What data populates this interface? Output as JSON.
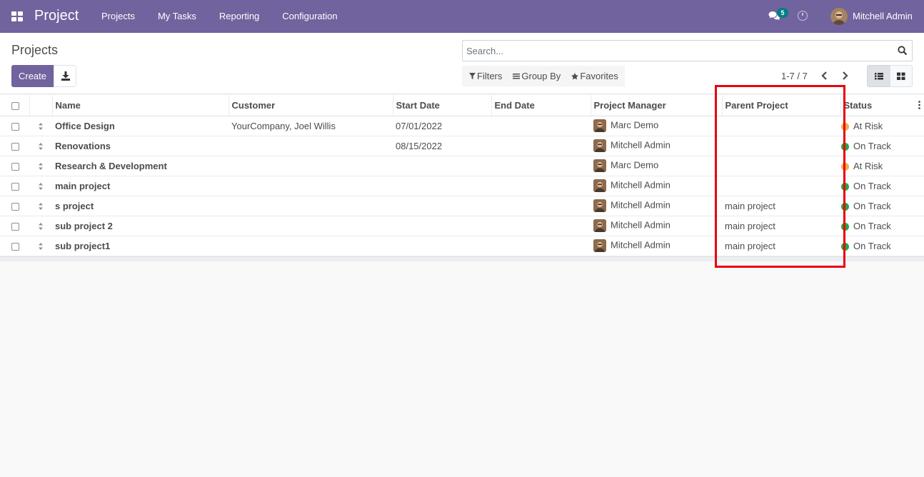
{
  "navbar": {
    "brand": "Project",
    "menu": [
      "Projects",
      "My Tasks",
      "Reporting",
      "Configuration"
    ],
    "chat_count": "5",
    "user_name": "Mitchell Admin",
    "bg_color": "#71639e"
  },
  "control_panel": {
    "title": "Projects",
    "create_label": "Create",
    "search_placeholder": "Search...",
    "filters_label": "Filters",
    "group_by_label": "Group By",
    "favorites_label": "Favorites",
    "pager": "1-7 / 7"
  },
  "table": {
    "columns": [
      "Name",
      "Customer",
      "Start Date",
      "End Date",
      "Project Manager",
      "Parent Project",
      "Status"
    ],
    "rows": [
      {
        "name": "Office Design",
        "customer": "YourCompany, Joel Willis",
        "start": "07/01/2022",
        "end": "",
        "manager": "Marc Demo",
        "parent": "",
        "status": "At Risk",
        "status_color": "#f0ad4e"
      },
      {
        "name": "Renovations",
        "customer": "",
        "start": "08/15/2022",
        "end": "",
        "manager": "Mitchell Admin",
        "parent": "",
        "status": "On Track",
        "status_color": "#28a745"
      },
      {
        "name": "Research & Development",
        "customer": "",
        "start": "",
        "end": "",
        "manager": "Marc Demo",
        "parent": "",
        "status": "At Risk",
        "status_color": "#f0ad4e"
      },
      {
        "name": "main project",
        "customer": "",
        "start": "",
        "end": "",
        "manager": "Mitchell Admin",
        "parent": "",
        "status": "On Track",
        "status_color": "#28a745"
      },
      {
        "name": "s project",
        "customer": "",
        "start": "",
        "end": "",
        "manager": "Mitchell Admin",
        "parent": "main project",
        "status": "On Track",
        "status_color": "#28a745"
      },
      {
        "name": "sub project 2",
        "customer": "",
        "start": "",
        "end": "",
        "manager": "Mitchell Admin",
        "parent": "main project",
        "status": "On Track",
        "status_color": "#28a745"
      },
      {
        "name": "sub project1",
        "customer": "",
        "start": "",
        "end": "",
        "manager": "Mitchell Admin",
        "parent": "main project",
        "status": "On Track",
        "status_color": "#28a745"
      }
    ]
  },
  "annotation": {
    "highlight_color": "#e8000f"
  }
}
